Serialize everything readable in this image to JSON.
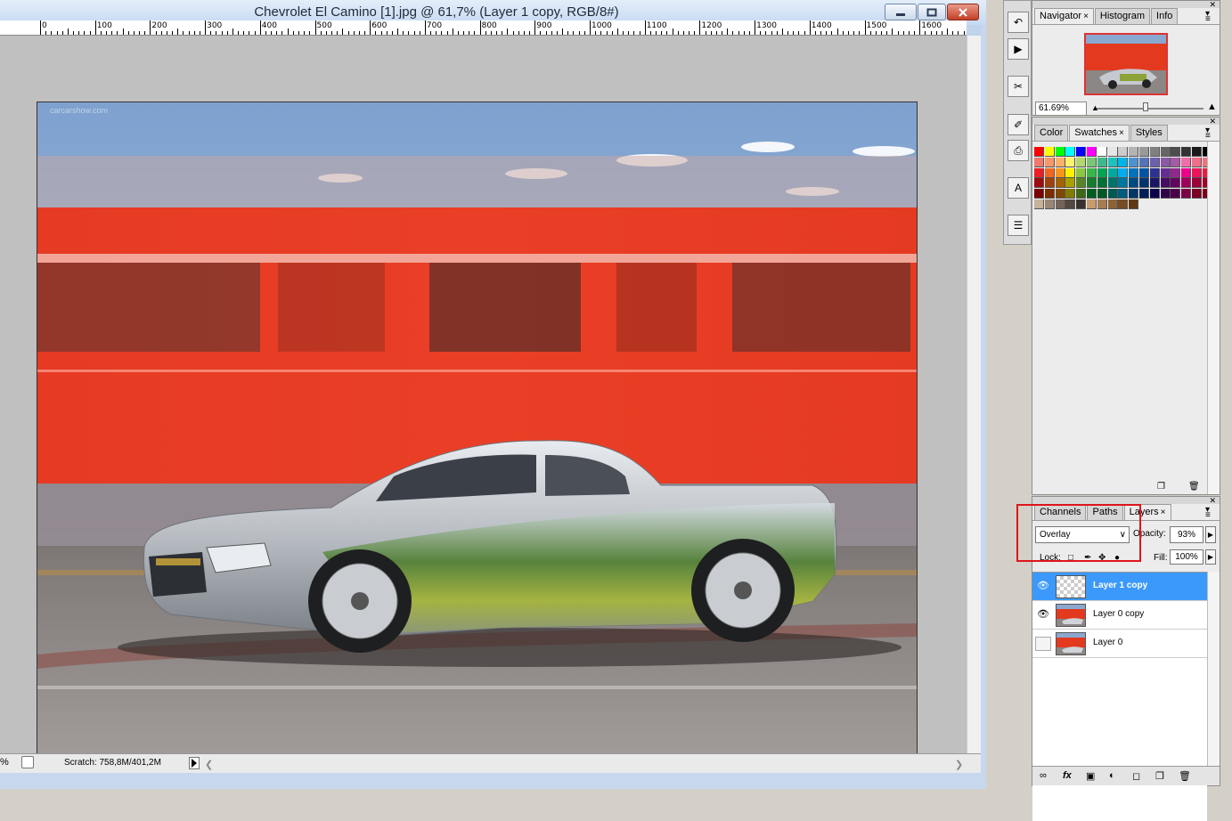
{
  "document": {
    "title": "Chevrolet El Camino [1].jpg @ 61,7% (Layer 1 copy, RGB/8#)",
    "ruler_labels": [
      "0",
      "100",
      "200",
      "300",
      "400",
      "500",
      "600",
      "700",
      "800",
      "900",
      "1000",
      "1100",
      "1200",
      "1300",
      "1400",
      "1500",
      "1600"
    ],
    "status": {
      "zoom_fragment": "%",
      "scratch": "Scratch: 758,8M/401,2M"
    },
    "watermark": "carcarshow.com"
  },
  "window_buttons": {
    "minimize": "minimize-icon",
    "maximize": "maximize-icon",
    "close": "close-icon"
  },
  "tools": [
    "history-icon",
    "actions-icon",
    "tool-presets-icon",
    "brushes-icon",
    "clone-source-icon",
    "character-icon",
    "paragraph-icon"
  ],
  "navigator_panel": {
    "tabs": [
      "Navigator",
      "Histogram",
      "Info"
    ],
    "zoom": "61.69%"
  },
  "swatches_panel": {
    "tabs": [
      "Color",
      "Swatches",
      "Styles"
    ],
    "row1": [
      "#ff0000",
      "#ffff00",
      "#00ff00",
      "#00ffff",
      "#0000ff",
      "#ff00ff",
      "#ffffff",
      "#e6e6e6",
      "#cccccc",
      "#b3b3b3",
      "#999999",
      "#808080",
      "#666666",
      "#4d4d4d",
      "#333333",
      "#1a1a1a",
      "#000000"
    ],
    "rows": [
      [
        "#f3786a",
        "#f7976a",
        "#fbb06c",
        "#fff36e",
        "#b3d66e",
        "#7cc576",
        "#3eb98b",
        "#1ec1bd",
        "#00b4e9",
        "#4c93d0",
        "#5673b8",
        "#6c61ad",
        "#8a5aa6",
        "#a45ba4",
        "#f06ea9",
        "#f36f89",
        "#f0737e"
      ],
      [
        "#ee1c25",
        "#f26522",
        "#f7941d",
        "#fff200",
        "#8dc63f",
        "#39b54a",
        "#00a651",
        "#00a99d",
        "#00aeef",
        "#0072bc",
        "#0054a6",
        "#2e3192",
        "#662d91",
        "#92278f",
        "#ec008c",
        "#ed145b",
        "#ea1c3d"
      ],
      [
        "#9e0b0f",
        "#a0410d",
        "#a36209",
        "#aba000",
        "#598527",
        "#197b30",
        "#007236",
        "#00746b",
        "#0076a3",
        "#004a80",
        "#003471",
        "#1b1464",
        "#440e62",
        "#630460",
        "#9e005d",
        "#9e0039",
        "#a0002a"
      ],
      [
        "#790000",
        "#7b2e00",
        "#7d4900",
        "#827b00",
        "#406618",
        "#005e20",
        "#005826",
        "#005952",
        "#005b7f",
        "#003663",
        "#002157",
        "#0d004c",
        "#32004b",
        "#4b0049",
        "#7b0046",
        "#7a0026",
        "#7a0018"
      ],
      [
        "#c7b299",
        "#998675",
        "#736357",
        "#534741",
        "#37302d",
        "#c69c6e",
        "#a67c52",
        "#8c6239",
        "#754c24",
        "#603913"
      ]
    ]
  },
  "layers_panel": {
    "tabs": [
      "Channels",
      "Paths",
      "Layers"
    ],
    "blend_mode": "Overlay",
    "opacity_label": "Opacity:",
    "opacity_value": "93%",
    "lock_label": "Lock:",
    "fill_label": "Fill:",
    "fill_value": "100%",
    "layers": [
      {
        "name": "Layer 1 copy",
        "visible": true,
        "selected": true
      },
      {
        "name": "Layer 0 copy",
        "visible": true,
        "selected": false
      },
      {
        "name": "Layer 0",
        "visible": false,
        "selected": false
      }
    ]
  },
  "colors": {
    "selection": "#3c99fc",
    "highlight": "#e0141b",
    "train_red": "#e4341f"
  }
}
